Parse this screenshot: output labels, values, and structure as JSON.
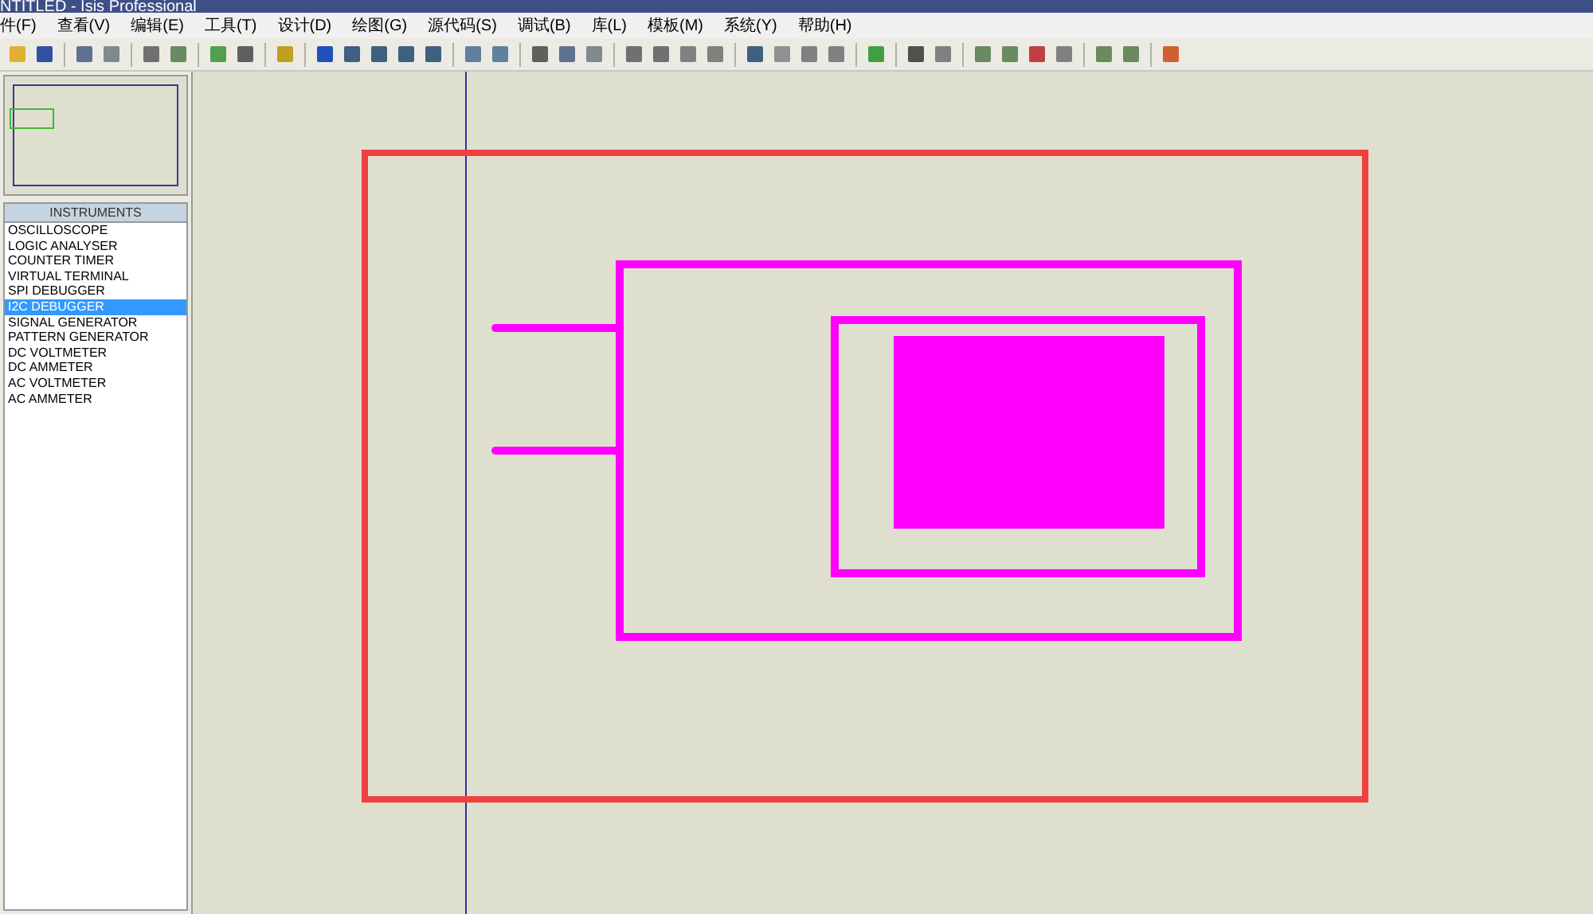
{
  "window": {
    "title": "NTITLED - Isis Professional"
  },
  "menu": [
    {
      "label": "件(F)"
    },
    {
      "label": "查看(V)"
    },
    {
      "label": "编辑(E)"
    },
    {
      "label": "工具(T)"
    },
    {
      "label": "设计(D)"
    },
    {
      "label": "绘图(G)"
    },
    {
      "label": "源代码(S)"
    },
    {
      "label": "调试(B)"
    },
    {
      "label": "库(L)"
    },
    {
      "label": "模板(M)"
    },
    {
      "label": "系统(Y)"
    },
    {
      "label": "帮助(H)"
    }
  ],
  "instruments": {
    "title": "INSTRUMENTS",
    "items": [
      {
        "label": "OSCILLOSCOPE",
        "selected": false
      },
      {
        "label": "LOGIC ANALYSER",
        "selected": false
      },
      {
        "label": "COUNTER TIMER",
        "selected": false
      },
      {
        "label": "VIRTUAL TERMINAL",
        "selected": false
      },
      {
        "label": "SPI DEBUGGER",
        "selected": false
      },
      {
        "label": "I2C DEBUGGER",
        "selected": true
      },
      {
        "label": "SIGNAL GENERATOR",
        "selected": false
      },
      {
        "label": "PATTERN GENERATOR",
        "selected": false
      },
      {
        "label": "DC VOLTMETER",
        "selected": false
      },
      {
        "label": "DC AMMETER",
        "selected": false
      },
      {
        "label": "AC VOLTMETER",
        "selected": false
      },
      {
        "label": "AC AMMETER",
        "selected": false
      }
    ]
  }
}
